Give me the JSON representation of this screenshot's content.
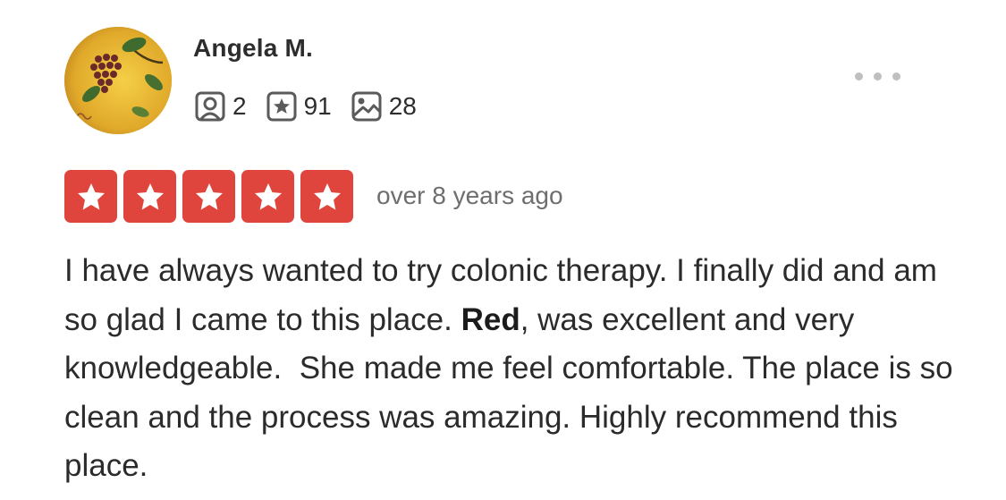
{
  "reviewer": {
    "name": "Angela M.",
    "avatar_icon": "grape-painting-avatar",
    "stats": [
      {
        "icon": "friends-icon",
        "value": "2"
      },
      {
        "icon": "reviews-star-icon",
        "value": "91"
      },
      {
        "icon": "photos-icon",
        "value": "28"
      }
    ]
  },
  "menu": {
    "icon": "more-options-icon"
  },
  "review": {
    "rating": 5,
    "rating_max": 5,
    "date": "over 8 years ago",
    "text_part1": "I have always wanted to try colonic therapy. I finally did and am so glad I came to this place. ",
    "text_bold": "Red",
    "text_part2": ", was excellent and very knowledgeable.  She made me feel comfortable. The place is so clean and the process was amazing. Highly recommend this place."
  },
  "colors": {
    "star_background": "#e0453d",
    "star_fill": "#ffffff",
    "text": "#2b2b2b",
    "muted_text": "#6e6e6e",
    "icon": "#5a5a5a"
  }
}
